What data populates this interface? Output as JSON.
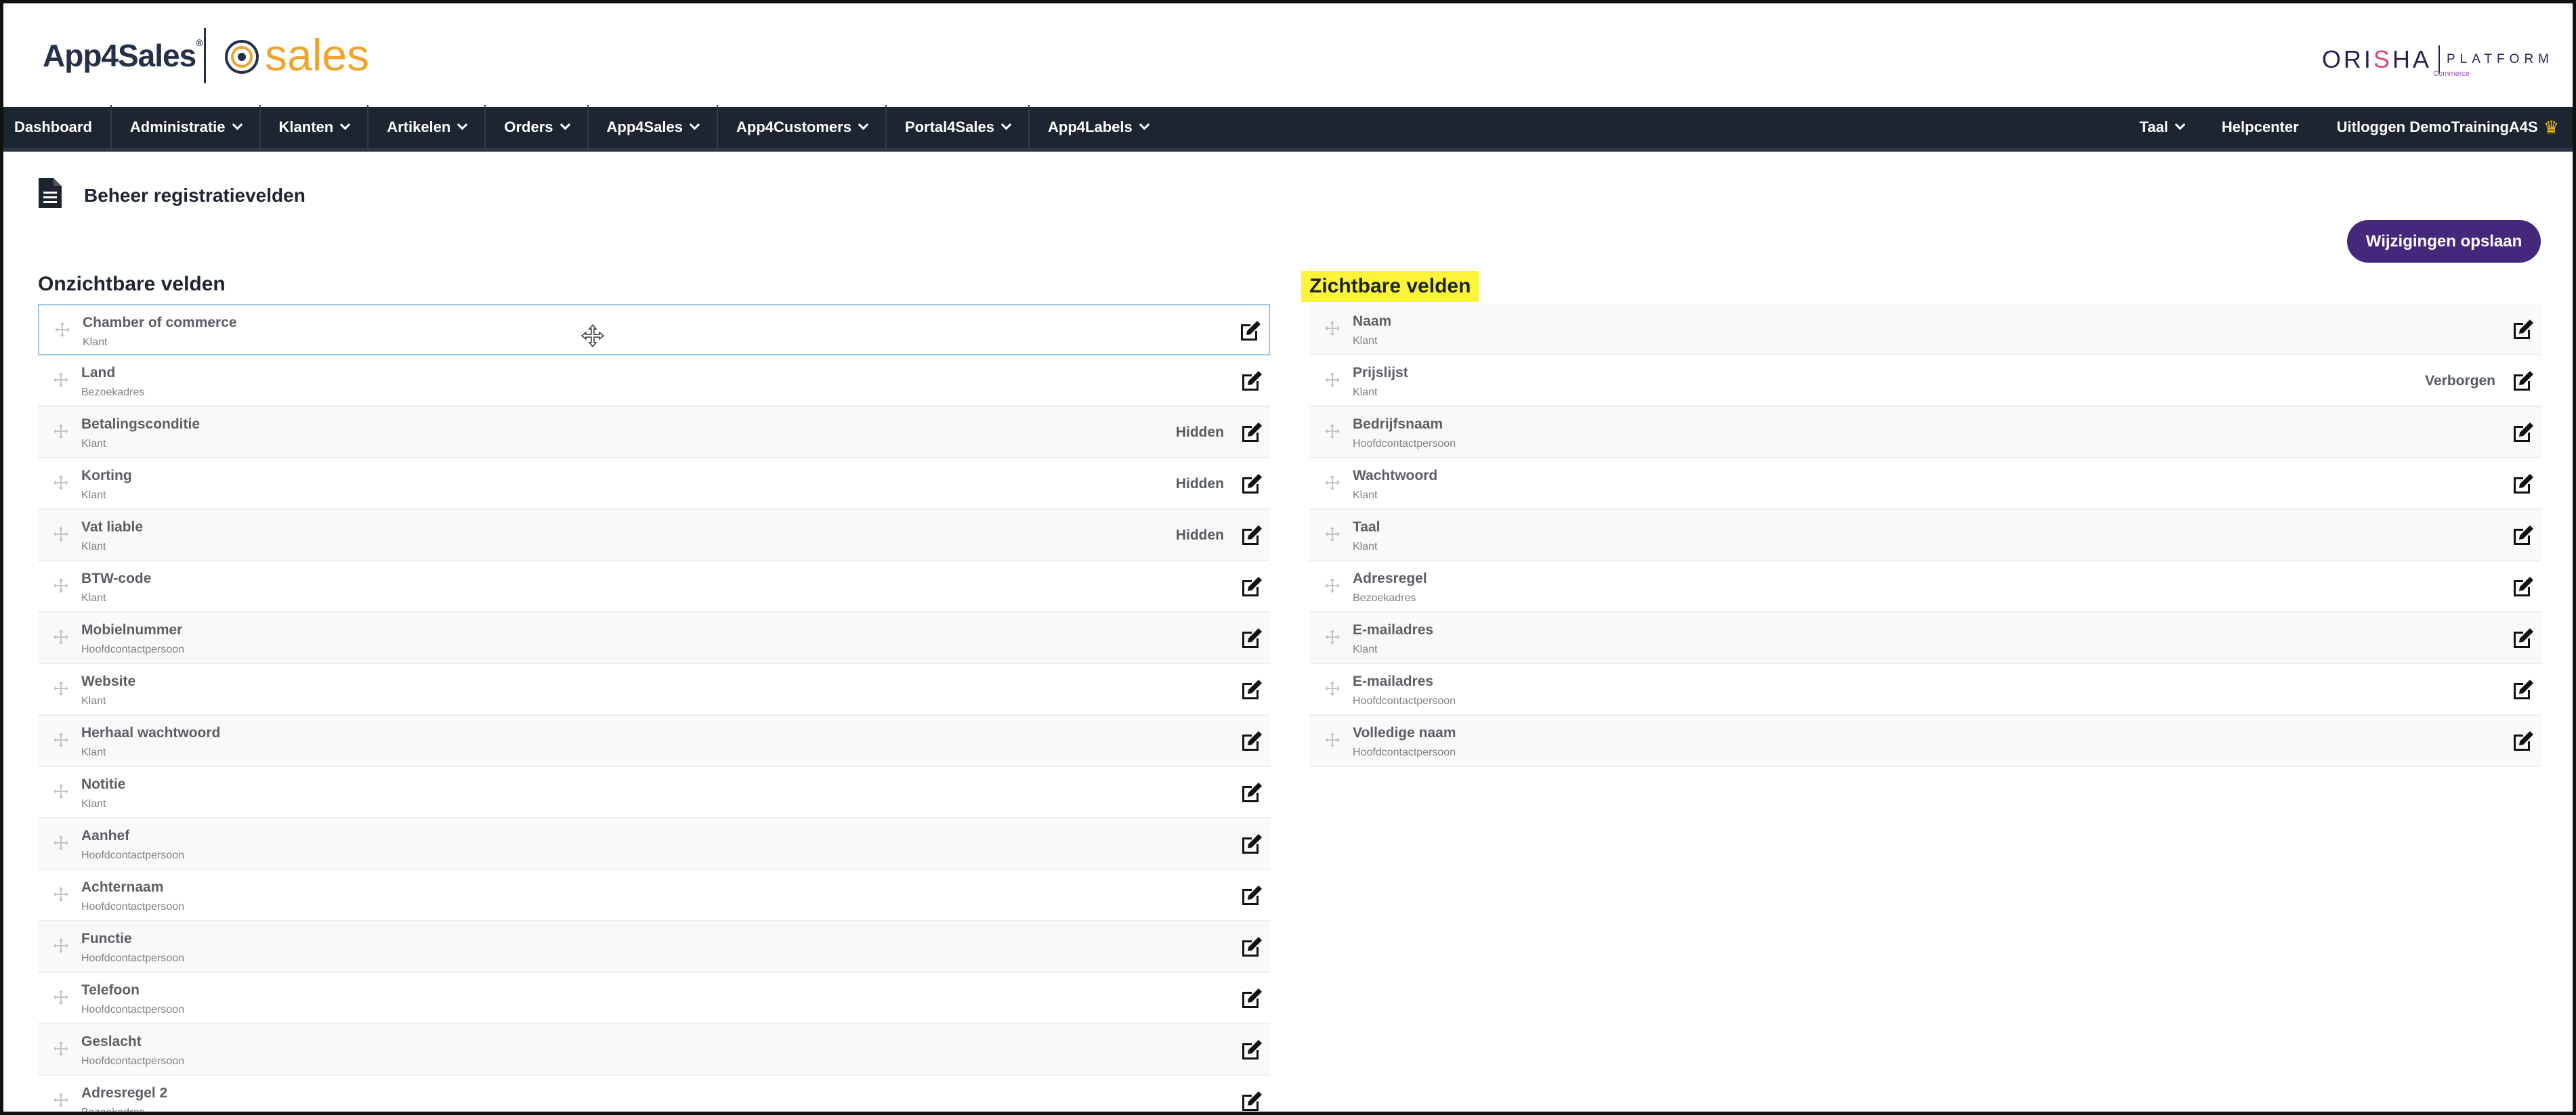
{
  "header": {
    "logo_app": "App4Sales",
    "logo_reg": "®",
    "logo_sales": "sales",
    "orisha_name_1": "ORI",
    "orisha_name_2": "S",
    "orisha_name_3": "HA",
    "orisha_platform": "PLATFORM",
    "orisha_commerce": "Commerce"
  },
  "nav": {
    "items": [
      {
        "label": "Dashboard"
      },
      {
        "label": "Administratie"
      },
      {
        "label": "Klanten"
      },
      {
        "label": "Artikelen"
      },
      {
        "label": "Orders"
      },
      {
        "label": "App4Sales"
      },
      {
        "label": "App4Customers"
      },
      {
        "label": "Portal4Sales"
      },
      {
        "label": "App4Labels"
      }
    ],
    "right": {
      "language": "Taal",
      "help": "Helpcenter",
      "logout": "Uitloggen",
      "user": "DemoTrainingA4S"
    }
  },
  "page": {
    "title": "Beheer registratievelden",
    "save_label": "Wijzigingen opslaan"
  },
  "invisible": {
    "heading": "Onzichtbare velden",
    "rows": [
      {
        "name": "Chamber of commerce",
        "sub": "Klant",
        "flag": ""
      },
      {
        "name": "Land",
        "sub": "Bezoekadres",
        "flag": ""
      },
      {
        "name": "Betalingsconditie",
        "sub": "Klant",
        "flag": "Hidden"
      },
      {
        "name": "Korting",
        "sub": "Klant",
        "flag": "Hidden"
      },
      {
        "name": "Vat liable",
        "sub": "Klant",
        "flag": "Hidden"
      },
      {
        "name": "BTW-code",
        "sub": "Klant",
        "flag": ""
      },
      {
        "name": "Mobielnummer",
        "sub": "Hoofdcontactpersoon",
        "flag": ""
      },
      {
        "name": "Website",
        "sub": "Klant",
        "flag": ""
      },
      {
        "name": "Herhaal wachtwoord",
        "sub": "Klant",
        "flag": ""
      },
      {
        "name": "Notitie",
        "sub": "Klant",
        "flag": ""
      },
      {
        "name": "Aanhef",
        "sub": "Hoofdcontactpersoon",
        "flag": ""
      },
      {
        "name": "Achternaam",
        "sub": "Hoofdcontactpersoon",
        "flag": ""
      },
      {
        "name": "Functie",
        "sub": "Hoofdcontactpersoon",
        "flag": ""
      },
      {
        "name": "Telefoon",
        "sub": "Hoofdcontactpersoon",
        "flag": ""
      },
      {
        "name": "Geslacht",
        "sub": "Hoofdcontactpersoon",
        "flag": ""
      },
      {
        "name": "Adresregel 2",
        "sub": "Bezoekadres",
        "flag": ""
      }
    ]
  },
  "visible": {
    "heading": "Zichtbare velden",
    "rows": [
      {
        "name": "Naam",
        "sub": "Klant",
        "flag": ""
      },
      {
        "name": "Prijslijst",
        "sub": "Klant",
        "flag": "Verborgen"
      },
      {
        "name": "Bedrijfsnaam",
        "sub": "Hoofdcontactpersoon",
        "flag": ""
      },
      {
        "name": "Wachtwoord",
        "sub": "Klant",
        "flag": ""
      },
      {
        "name": "Taal",
        "sub": "Klant",
        "flag": ""
      },
      {
        "name": "Adresregel",
        "sub": "Bezoekadres",
        "flag": ""
      },
      {
        "name": "E-mailadres",
        "sub": "Klant",
        "flag": ""
      },
      {
        "name": "E-mailadres",
        "sub": "Hoofdcontactpersoon",
        "flag": ""
      },
      {
        "name": "Volledige naam",
        "sub": "Hoofdcontactpersoon",
        "flag": ""
      }
    ]
  },
  "colors": {
    "nav_bg": "#1c2530",
    "button_bg": "#44287b",
    "highlight": "#fcf33a",
    "sales_orange": "#f1a42b"
  }
}
